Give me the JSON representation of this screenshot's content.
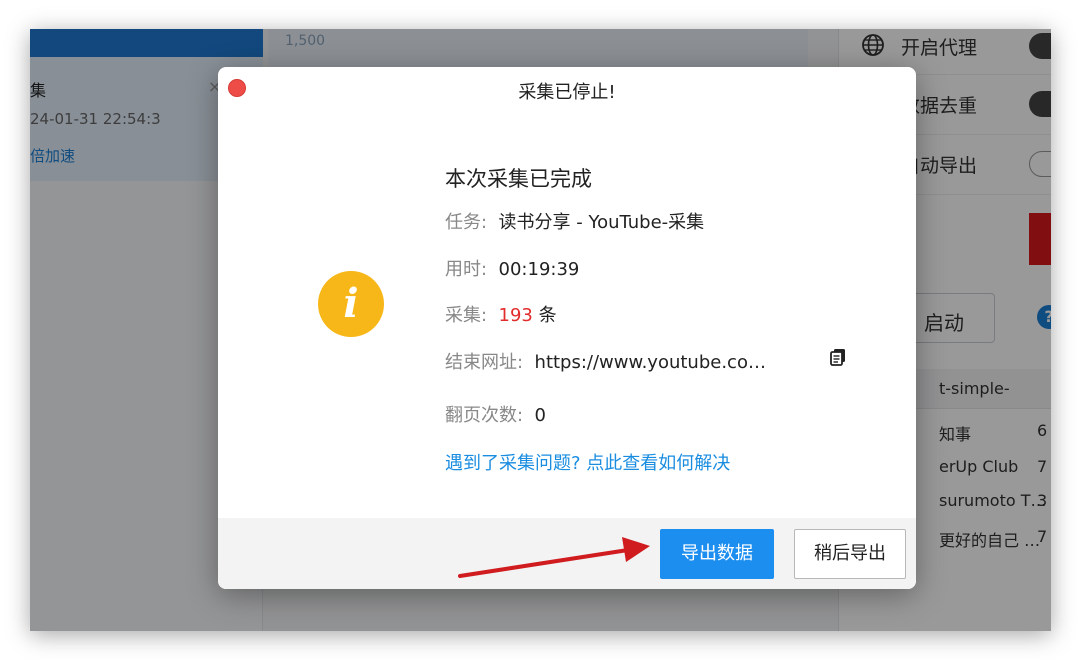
{
  "background": {
    "left_panel": {
      "task_title": "集",
      "task_close": "×",
      "task_time": "24-01-31 22:54:3",
      "task_speed": "倍加速"
    },
    "chart_axis_label": "1,500",
    "right_panel": {
      "proxy_label": "开启代理",
      "dedupe_label": "数据去重",
      "auto_export_label": "自动导出",
      "start_label": "启动",
      "help_glyph": "?",
      "table_header": "t-simple-",
      "rows": [
        {
          "name": "知事",
          "num": "6"
        },
        {
          "name": "erUp Club",
          "num": "7"
        },
        {
          "name": "surumoto T…",
          "num": "3"
        },
        {
          "name": "更好的自己 …",
          "num": "7"
        }
      ]
    }
  },
  "modal": {
    "title": "采集已停止!",
    "summary_title": "本次采集已完成",
    "task_label": "任务:",
    "task_value": "读书分享 - YouTube-采集",
    "duration_label": "用时:",
    "duration_value": "00:19:39",
    "count_label": "采集:",
    "count_value": "193",
    "count_unit": "条",
    "end_url_label": "结束网址:",
    "end_url_value": "https://www.youtube.co…",
    "pages_label": "翻页次数:",
    "pages_value": "0",
    "help_link": "遇到了采集问题? 点此查看如何解决",
    "info_glyph": "i",
    "export_button": "导出数据",
    "later_button": "稍后导出"
  },
  "colors": {
    "accent_blue": "#1c8ef0",
    "info_yellow": "#f8b718",
    "count_red": "#e22b2b",
    "close_red": "#ee4d47",
    "arrow_red": "#d01c1f"
  },
  "icons": [
    "globe-icon",
    "info-icon",
    "copy-icon",
    "close-dot-icon",
    "help-icon",
    "arrow-annotation"
  ]
}
